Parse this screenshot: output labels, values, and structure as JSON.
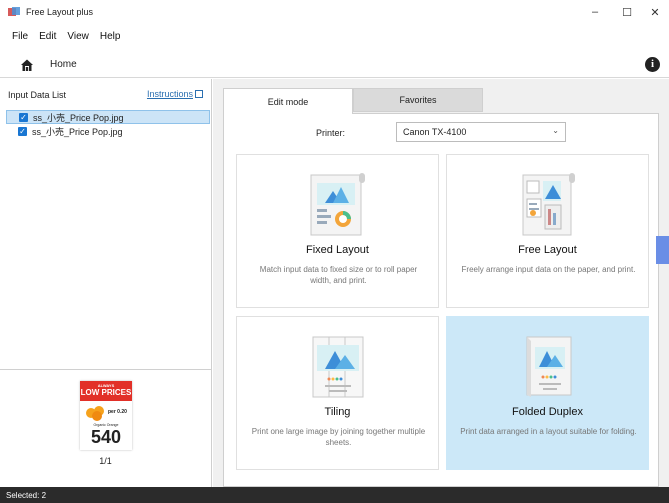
{
  "window": {
    "title": "Free Layout plus",
    "controls": {
      "minimize": "–",
      "maximize": "☐",
      "close": "✕"
    }
  },
  "menu": [
    {
      "label": "File"
    },
    {
      "label": "Edit"
    },
    {
      "label": "View"
    },
    {
      "label": "Help"
    }
  ],
  "home": {
    "label": "Home"
  },
  "left": {
    "heading": "Input Data List",
    "instructions": "Instructions",
    "files": [
      {
        "name": "ss_小売_Price Pop.jpg",
        "checked": true
      },
      {
        "name": "ss_小売_Price Pop.jpg",
        "checked": true
      }
    ],
    "preview": {
      "always": "ALWAYS",
      "low_prices": "LOW PRICES",
      "small_price": "per 0.20",
      "organic": "Organic Orange",
      "price": "540",
      "page": "1/1"
    }
  },
  "tabs": [
    {
      "label": "Edit mode"
    },
    {
      "label": "Favorites"
    }
  ],
  "printer": {
    "label": "Printer:",
    "value": "Canon TX-4100"
  },
  "modes": [
    {
      "title": "Fixed Layout",
      "description": "Match input data to fixed size or to roll paper width, and print."
    },
    {
      "title": "Free Layout",
      "description": "Freely arrange input data on the paper, and print."
    },
    {
      "title": "Tiling",
      "description": "Print one large image by joining together multiple sheets."
    },
    {
      "title": "Folded Duplex",
      "description": "Print data arranged in a layout suitable for folding."
    }
  ],
  "status": {
    "text": "Selected: 2"
  },
  "colors": {
    "accent": "#1976d2",
    "selected_card": "#cce8f8",
    "status_bar": "#2b2b2b",
    "price_red": "#e23028"
  }
}
